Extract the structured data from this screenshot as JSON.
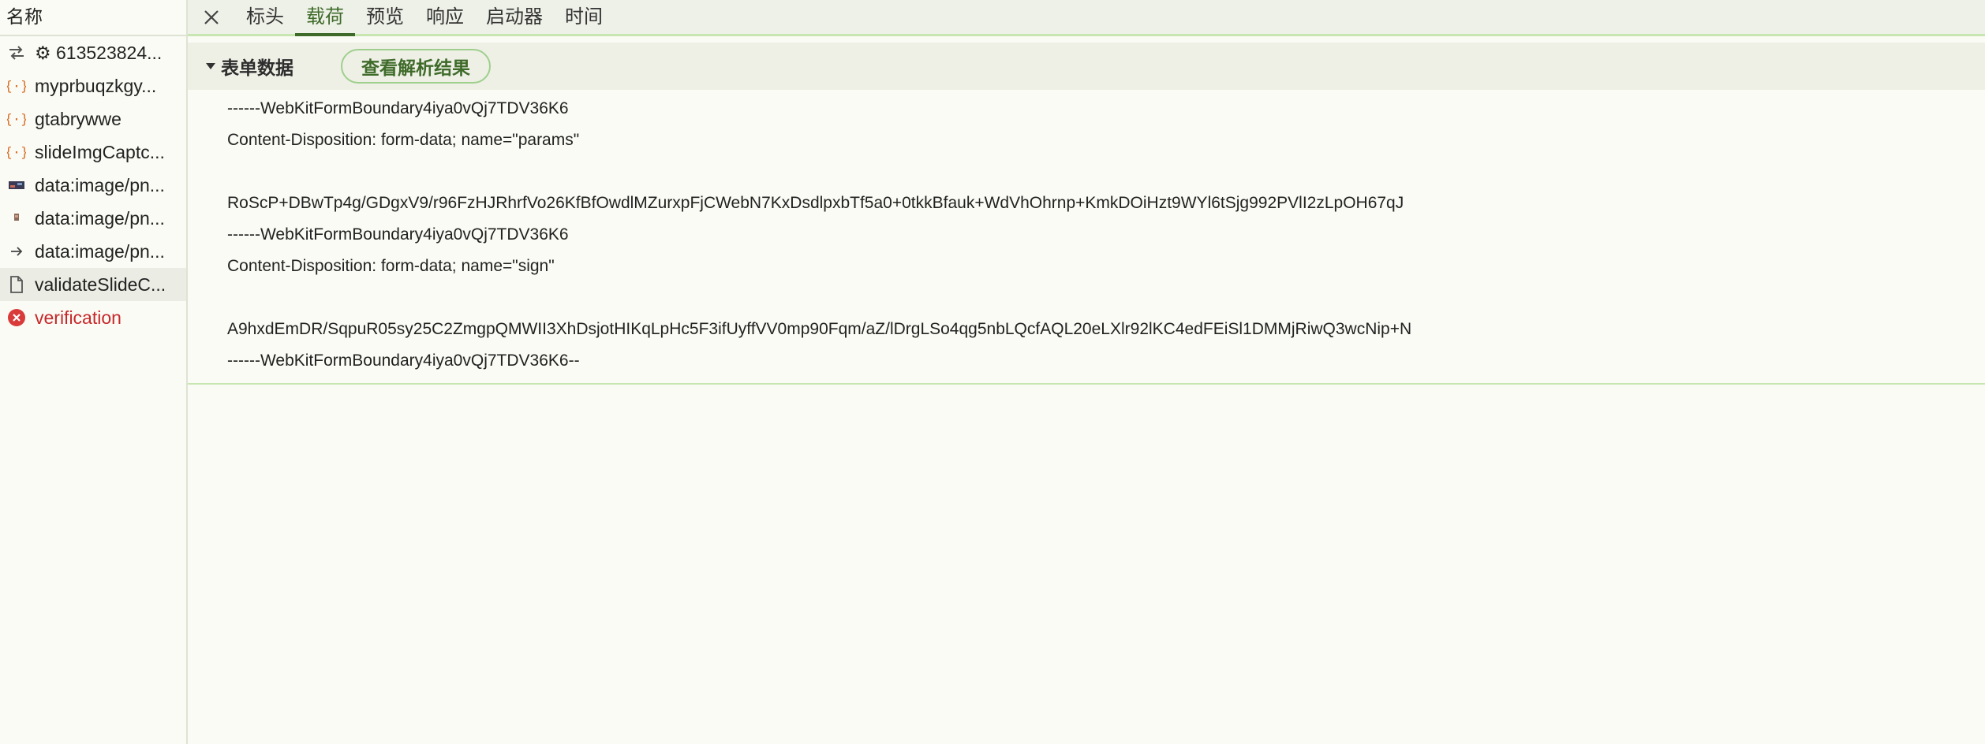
{
  "sidebar": {
    "header": "名称",
    "requests": [
      {
        "label": "⚙ 613523824...",
        "icon": "exchange-arrows-icon",
        "error": false,
        "selected": false
      },
      {
        "label": "myprbuqzkgy...",
        "icon": "json-braces-icon",
        "error": false,
        "selected": false
      },
      {
        "label": "gtabrywwe",
        "icon": "json-braces-icon",
        "error": false,
        "selected": false
      },
      {
        "label": "slideImgCaptc...",
        "icon": "json-braces-icon",
        "error": false,
        "selected": false
      },
      {
        "label": "data:image/pn...",
        "icon": "image-thumbnail-icon",
        "error": false,
        "selected": false
      },
      {
        "label": "data:image/pn...",
        "icon": "image-small-icon",
        "error": false,
        "selected": false
      },
      {
        "label": "data:image/pn...",
        "icon": "arrow-right-icon",
        "error": false,
        "selected": false
      },
      {
        "label": "validateSlideC...",
        "icon": "document-icon",
        "error": false,
        "selected": true
      },
      {
        "label": "verification",
        "icon": "error-circle-icon",
        "error": true,
        "selected": false
      }
    ]
  },
  "tabs": {
    "items": [
      {
        "label": "标头",
        "active": false
      },
      {
        "label": "载荷",
        "active": true
      },
      {
        "label": "预览",
        "active": false
      },
      {
        "label": "响应",
        "active": false
      },
      {
        "label": "启动器",
        "active": false
      },
      {
        "label": "时间",
        "active": false
      }
    ]
  },
  "payload": {
    "section_title": "表单数据",
    "parsed_button": "查看解析结果",
    "lines": [
      "------WebKitFormBoundary4iya0vQj7TDV36K6",
      "Content-Disposition: form-data; name=\"params\"",
      "",
      "RoScP+DBwTp4g/GDgxV9/r96FzHJRhrfVo26KfBfOwdlMZurxpFjCWebN7KxDsdlpxbTf5a0+0tkkBfauk+WdVhOhrnp+KmkDOiHzt9WYl6tSjg992PVlI2zLpOH67qJ",
      "------WebKitFormBoundary4iya0vQj7TDV36K6",
      "Content-Disposition: form-data; name=\"sign\"",
      "",
      "A9hxdEmDR/SqpuR05sy25C2ZmgpQMWII3XhDsjotHIKqLpHc5F3ifUyffVV0mp90Fqm/aZ/lDrgLSo4qg5nbLQcfAQL20eLXlr92lKC4edFEiSl1DMMjRiwQ3wcNip+N",
      "------WebKitFormBoundary4iya0vQj7TDV36K6--"
    ]
  },
  "colors": {
    "accent": "#3f6b2a",
    "error": "#c6282a",
    "json_icon": "#d9732e"
  }
}
